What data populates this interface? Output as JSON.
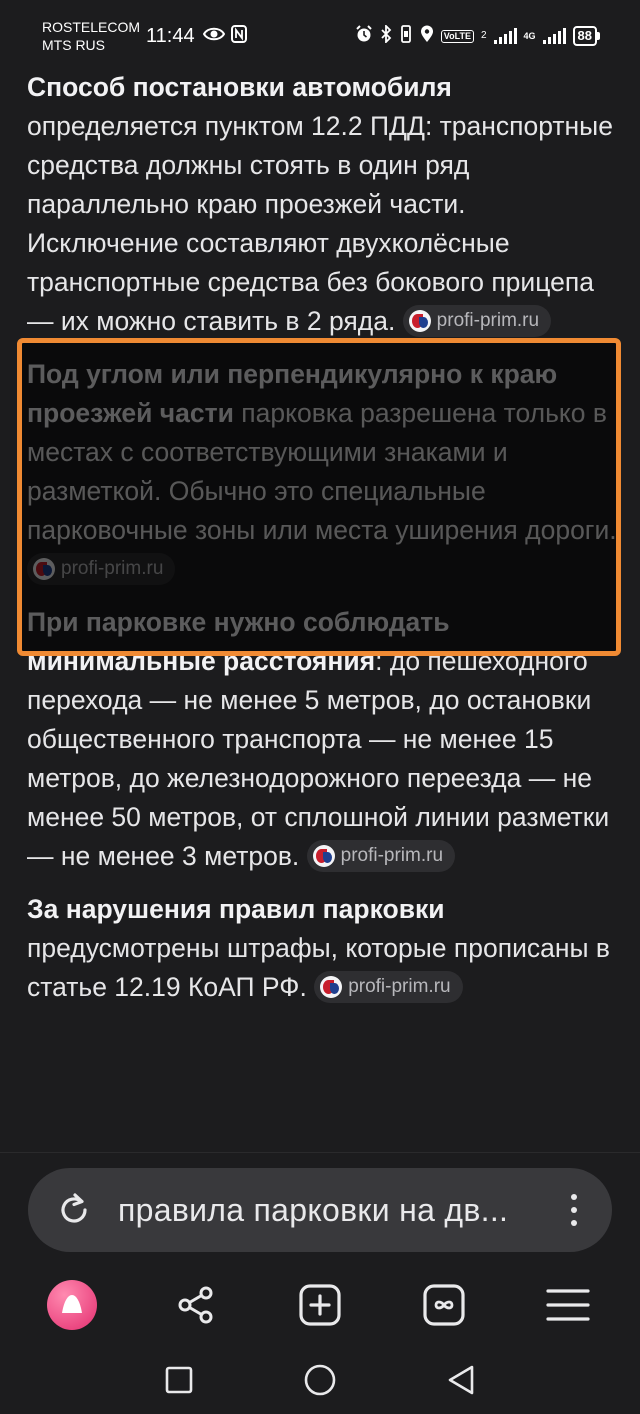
{
  "status_bar": {
    "carrier_1": "ROSTELECOM",
    "carrier_2": "MTS RUS",
    "time": "11:44",
    "volte_label": "VoLTE",
    "sim_index": "2",
    "network_1": "4G",
    "battery": "88",
    "icons": [
      "eye-icon",
      "nfc-icon",
      "alarm-icon",
      "bluetooth-icon",
      "vibrate-icon",
      "location-icon",
      "volte-icon",
      "signal-icon",
      "battery-icon"
    ]
  },
  "article": {
    "paragraphs": [
      {
        "bold": "Способ постановки автомобиля",
        "text": " определяется пунктом 12.2 ПДД: транспортные средства должны стоять в один ряд параллельно краю проезжей части. Исключение составляют двухколёсные транспортные средства без бокового прицепа — их можно ставить в 2 ряда. ",
        "source": "profi-prim.ru"
      },
      {
        "bold": "Под углом или перпендикулярно к краю проезжей части",
        "text": " парковка разрешена только в местах с соответствующими знаками и разметкой. Обычно это специальные парковочные зоны или места уширения дороги. ",
        "source": "profi-prim.ru"
      },
      {
        "bold": "При парковке нужно соблюдать минимальные расстояния",
        "text": ": до пешеходного перехода — не менее 5 метров, до остановки общественного транспорта — не менее 15 метров, до железнодорожного переезда — не менее 50 метров, от сплошной линии разметки — не менее 3 метров. ",
        "source": "profi-prim.ru"
      },
      {
        "bold": "За нарушения правил парковки",
        "text": " предусмотрены штрафы, которые прописаны в статье 12.19 КоАП РФ. ",
        "source": "profi-prim.ru"
      }
    ]
  },
  "search": {
    "query": "правила парковки на дв..."
  },
  "toolbar": {
    "items": [
      "alice-icon",
      "share-icon",
      "new-tab-icon",
      "tabs-icon",
      "menu-icon"
    ]
  },
  "colors": {
    "background": "#1c1c1e",
    "highlight": "#f08a33",
    "alice": "#f25a8c"
  }
}
